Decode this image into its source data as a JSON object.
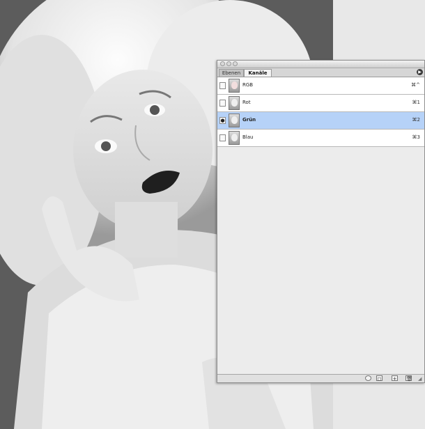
{
  "document": {
    "image_description_icon": "photo-portrait-icon"
  },
  "palette": {
    "tabs": [
      {
        "label": "Ebenen",
        "active": false
      },
      {
        "label": "Kanäle",
        "active": true
      }
    ],
    "menu_icon": "palette-menu-arrow-icon",
    "channels": [
      {
        "name": "RGB",
        "shortcut": "⌘^",
        "visible": false,
        "selected": false
      },
      {
        "name": "Rot",
        "shortcut": "⌘1",
        "visible": false,
        "selected": false
      },
      {
        "name": "Grün",
        "shortcut": "⌘2",
        "visible": true,
        "selected": true
      },
      {
        "name": "Blau",
        "shortcut": "⌘3",
        "visible": false,
        "selected": false
      }
    ],
    "bottom_icons": [
      "load-selection-icon",
      "save-selection-icon",
      "new-channel-icon",
      "delete-channel-icon"
    ],
    "colors": {
      "selected_row": "#b6d2f8",
      "panel_bg": "#ececec"
    }
  }
}
